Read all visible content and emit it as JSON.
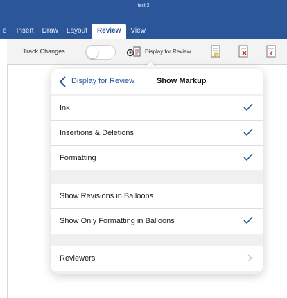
{
  "window": {
    "title": "test 2"
  },
  "tabs": [
    {
      "label": "e"
    },
    {
      "label": "Insert"
    },
    {
      "label": "Draw"
    },
    {
      "label": "Layout"
    },
    {
      "label": "Review",
      "active": true
    },
    {
      "label": "View"
    }
  ],
  "ribbon": {
    "track_changes_label": "Track Changes",
    "track_changes_on": false,
    "display_for_review_label": "Display for Review"
  },
  "popover": {
    "back_label": "Display for Review",
    "title": "Show Markup",
    "group1": [
      {
        "label": "Ink",
        "checked": true
      },
      {
        "label": "Insertions & Deletions",
        "checked": true
      },
      {
        "label": "Formatting",
        "checked": true
      }
    ],
    "group2": [
      {
        "label": "Show Revisions in Balloons",
        "checked": false
      },
      {
        "label": "Show Only Formatting in Balloons",
        "checked": true
      }
    ],
    "group3": [
      {
        "label": "Reviewers",
        "has_submenu": true
      }
    ]
  },
  "colors": {
    "brand": "#2b579a",
    "check": "#2b579a"
  }
}
